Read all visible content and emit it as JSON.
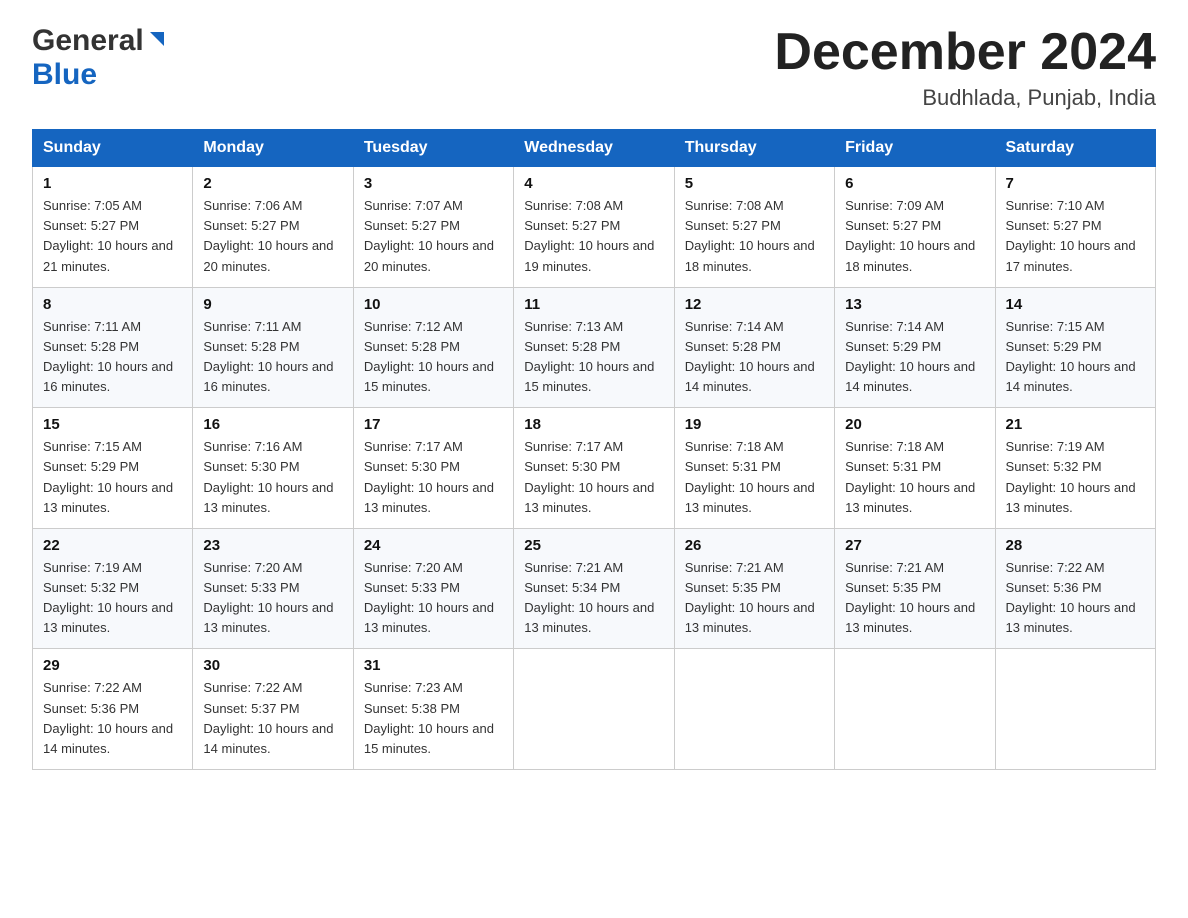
{
  "header": {
    "logo_general": "General",
    "logo_blue": "Blue",
    "month_title": "December 2024",
    "subtitle": "Budhlada, Punjab, India"
  },
  "weekdays": [
    "Sunday",
    "Monday",
    "Tuesday",
    "Wednesday",
    "Thursday",
    "Friday",
    "Saturday"
  ],
  "weeks": [
    [
      {
        "day": "1",
        "sunrise": "7:05 AM",
        "sunset": "5:27 PM",
        "daylight": "10 hours and 21 minutes."
      },
      {
        "day": "2",
        "sunrise": "7:06 AM",
        "sunset": "5:27 PM",
        "daylight": "10 hours and 20 minutes."
      },
      {
        "day": "3",
        "sunrise": "7:07 AM",
        "sunset": "5:27 PM",
        "daylight": "10 hours and 20 minutes."
      },
      {
        "day": "4",
        "sunrise": "7:08 AM",
        "sunset": "5:27 PM",
        "daylight": "10 hours and 19 minutes."
      },
      {
        "day": "5",
        "sunrise": "7:08 AM",
        "sunset": "5:27 PM",
        "daylight": "10 hours and 18 minutes."
      },
      {
        "day": "6",
        "sunrise": "7:09 AM",
        "sunset": "5:27 PM",
        "daylight": "10 hours and 18 minutes."
      },
      {
        "day": "7",
        "sunrise": "7:10 AM",
        "sunset": "5:27 PM",
        "daylight": "10 hours and 17 minutes."
      }
    ],
    [
      {
        "day": "8",
        "sunrise": "7:11 AM",
        "sunset": "5:28 PM",
        "daylight": "10 hours and 16 minutes."
      },
      {
        "day": "9",
        "sunrise": "7:11 AM",
        "sunset": "5:28 PM",
        "daylight": "10 hours and 16 minutes."
      },
      {
        "day": "10",
        "sunrise": "7:12 AM",
        "sunset": "5:28 PM",
        "daylight": "10 hours and 15 minutes."
      },
      {
        "day": "11",
        "sunrise": "7:13 AM",
        "sunset": "5:28 PM",
        "daylight": "10 hours and 15 minutes."
      },
      {
        "day": "12",
        "sunrise": "7:14 AM",
        "sunset": "5:28 PM",
        "daylight": "10 hours and 14 minutes."
      },
      {
        "day": "13",
        "sunrise": "7:14 AM",
        "sunset": "5:29 PM",
        "daylight": "10 hours and 14 minutes."
      },
      {
        "day": "14",
        "sunrise": "7:15 AM",
        "sunset": "5:29 PM",
        "daylight": "10 hours and 14 minutes."
      }
    ],
    [
      {
        "day": "15",
        "sunrise": "7:15 AM",
        "sunset": "5:29 PM",
        "daylight": "10 hours and 13 minutes."
      },
      {
        "day": "16",
        "sunrise": "7:16 AM",
        "sunset": "5:30 PM",
        "daylight": "10 hours and 13 minutes."
      },
      {
        "day": "17",
        "sunrise": "7:17 AM",
        "sunset": "5:30 PM",
        "daylight": "10 hours and 13 minutes."
      },
      {
        "day": "18",
        "sunrise": "7:17 AM",
        "sunset": "5:30 PM",
        "daylight": "10 hours and 13 minutes."
      },
      {
        "day": "19",
        "sunrise": "7:18 AM",
        "sunset": "5:31 PM",
        "daylight": "10 hours and 13 minutes."
      },
      {
        "day": "20",
        "sunrise": "7:18 AM",
        "sunset": "5:31 PM",
        "daylight": "10 hours and 13 minutes."
      },
      {
        "day": "21",
        "sunrise": "7:19 AM",
        "sunset": "5:32 PM",
        "daylight": "10 hours and 13 minutes."
      }
    ],
    [
      {
        "day": "22",
        "sunrise": "7:19 AM",
        "sunset": "5:32 PM",
        "daylight": "10 hours and 13 minutes."
      },
      {
        "day": "23",
        "sunrise": "7:20 AM",
        "sunset": "5:33 PM",
        "daylight": "10 hours and 13 minutes."
      },
      {
        "day": "24",
        "sunrise": "7:20 AM",
        "sunset": "5:33 PM",
        "daylight": "10 hours and 13 minutes."
      },
      {
        "day": "25",
        "sunrise": "7:21 AM",
        "sunset": "5:34 PM",
        "daylight": "10 hours and 13 minutes."
      },
      {
        "day": "26",
        "sunrise": "7:21 AM",
        "sunset": "5:35 PM",
        "daylight": "10 hours and 13 minutes."
      },
      {
        "day": "27",
        "sunrise": "7:21 AM",
        "sunset": "5:35 PM",
        "daylight": "10 hours and 13 minutes."
      },
      {
        "day": "28",
        "sunrise": "7:22 AM",
        "sunset": "5:36 PM",
        "daylight": "10 hours and 13 minutes."
      }
    ],
    [
      {
        "day": "29",
        "sunrise": "7:22 AM",
        "sunset": "5:36 PM",
        "daylight": "10 hours and 14 minutes."
      },
      {
        "day": "30",
        "sunrise": "7:22 AM",
        "sunset": "5:37 PM",
        "daylight": "10 hours and 14 minutes."
      },
      {
        "day": "31",
        "sunrise": "7:23 AM",
        "sunset": "5:38 PM",
        "daylight": "10 hours and 15 minutes."
      },
      null,
      null,
      null,
      null
    ]
  ]
}
